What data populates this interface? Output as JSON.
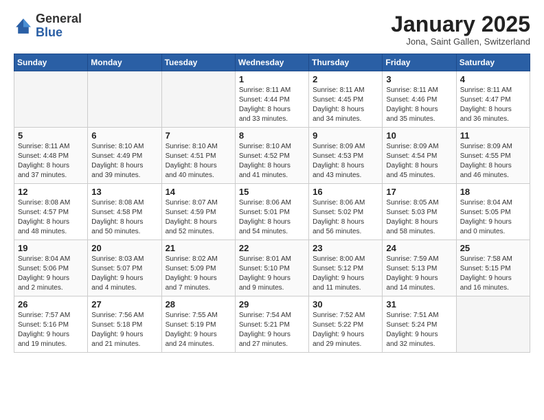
{
  "header": {
    "logo_general": "General",
    "logo_blue": "Blue",
    "month_title": "January 2025",
    "location": "Jona, Saint Gallen, Switzerland"
  },
  "days_of_week": [
    "Sunday",
    "Monday",
    "Tuesday",
    "Wednesday",
    "Thursday",
    "Friday",
    "Saturday"
  ],
  "weeks": [
    [
      {
        "day": "",
        "info": ""
      },
      {
        "day": "",
        "info": ""
      },
      {
        "day": "",
        "info": ""
      },
      {
        "day": "1",
        "info": "Sunrise: 8:11 AM\nSunset: 4:44 PM\nDaylight: 8 hours\nand 33 minutes."
      },
      {
        "day": "2",
        "info": "Sunrise: 8:11 AM\nSunset: 4:45 PM\nDaylight: 8 hours\nand 34 minutes."
      },
      {
        "day": "3",
        "info": "Sunrise: 8:11 AM\nSunset: 4:46 PM\nDaylight: 8 hours\nand 35 minutes."
      },
      {
        "day": "4",
        "info": "Sunrise: 8:11 AM\nSunset: 4:47 PM\nDaylight: 8 hours\nand 36 minutes."
      }
    ],
    [
      {
        "day": "5",
        "info": "Sunrise: 8:11 AM\nSunset: 4:48 PM\nDaylight: 8 hours\nand 37 minutes."
      },
      {
        "day": "6",
        "info": "Sunrise: 8:10 AM\nSunset: 4:49 PM\nDaylight: 8 hours\nand 39 minutes."
      },
      {
        "day": "7",
        "info": "Sunrise: 8:10 AM\nSunset: 4:51 PM\nDaylight: 8 hours\nand 40 minutes."
      },
      {
        "day": "8",
        "info": "Sunrise: 8:10 AM\nSunset: 4:52 PM\nDaylight: 8 hours\nand 41 minutes."
      },
      {
        "day": "9",
        "info": "Sunrise: 8:09 AM\nSunset: 4:53 PM\nDaylight: 8 hours\nand 43 minutes."
      },
      {
        "day": "10",
        "info": "Sunrise: 8:09 AM\nSunset: 4:54 PM\nDaylight: 8 hours\nand 45 minutes."
      },
      {
        "day": "11",
        "info": "Sunrise: 8:09 AM\nSunset: 4:55 PM\nDaylight: 8 hours\nand 46 minutes."
      }
    ],
    [
      {
        "day": "12",
        "info": "Sunrise: 8:08 AM\nSunset: 4:57 PM\nDaylight: 8 hours\nand 48 minutes."
      },
      {
        "day": "13",
        "info": "Sunrise: 8:08 AM\nSunset: 4:58 PM\nDaylight: 8 hours\nand 50 minutes."
      },
      {
        "day": "14",
        "info": "Sunrise: 8:07 AM\nSunset: 4:59 PM\nDaylight: 8 hours\nand 52 minutes."
      },
      {
        "day": "15",
        "info": "Sunrise: 8:06 AM\nSunset: 5:01 PM\nDaylight: 8 hours\nand 54 minutes."
      },
      {
        "day": "16",
        "info": "Sunrise: 8:06 AM\nSunset: 5:02 PM\nDaylight: 8 hours\nand 56 minutes."
      },
      {
        "day": "17",
        "info": "Sunrise: 8:05 AM\nSunset: 5:03 PM\nDaylight: 8 hours\nand 58 minutes."
      },
      {
        "day": "18",
        "info": "Sunrise: 8:04 AM\nSunset: 5:05 PM\nDaylight: 9 hours\nand 0 minutes."
      }
    ],
    [
      {
        "day": "19",
        "info": "Sunrise: 8:04 AM\nSunset: 5:06 PM\nDaylight: 9 hours\nand 2 minutes."
      },
      {
        "day": "20",
        "info": "Sunrise: 8:03 AM\nSunset: 5:07 PM\nDaylight: 9 hours\nand 4 minutes."
      },
      {
        "day": "21",
        "info": "Sunrise: 8:02 AM\nSunset: 5:09 PM\nDaylight: 9 hours\nand 7 minutes."
      },
      {
        "day": "22",
        "info": "Sunrise: 8:01 AM\nSunset: 5:10 PM\nDaylight: 9 hours\nand 9 minutes."
      },
      {
        "day": "23",
        "info": "Sunrise: 8:00 AM\nSunset: 5:12 PM\nDaylight: 9 hours\nand 11 minutes."
      },
      {
        "day": "24",
        "info": "Sunrise: 7:59 AM\nSunset: 5:13 PM\nDaylight: 9 hours\nand 14 minutes."
      },
      {
        "day": "25",
        "info": "Sunrise: 7:58 AM\nSunset: 5:15 PM\nDaylight: 9 hours\nand 16 minutes."
      }
    ],
    [
      {
        "day": "26",
        "info": "Sunrise: 7:57 AM\nSunset: 5:16 PM\nDaylight: 9 hours\nand 19 minutes."
      },
      {
        "day": "27",
        "info": "Sunrise: 7:56 AM\nSunset: 5:18 PM\nDaylight: 9 hours\nand 21 minutes."
      },
      {
        "day": "28",
        "info": "Sunrise: 7:55 AM\nSunset: 5:19 PM\nDaylight: 9 hours\nand 24 minutes."
      },
      {
        "day": "29",
        "info": "Sunrise: 7:54 AM\nSunset: 5:21 PM\nDaylight: 9 hours\nand 27 minutes."
      },
      {
        "day": "30",
        "info": "Sunrise: 7:52 AM\nSunset: 5:22 PM\nDaylight: 9 hours\nand 29 minutes."
      },
      {
        "day": "31",
        "info": "Sunrise: 7:51 AM\nSunset: 5:24 PM\nDaylight: 9 hours\nand 32 minutes."
      },
      {
        "day": "",
        "info": ""
      }
    ]
  ]
}
